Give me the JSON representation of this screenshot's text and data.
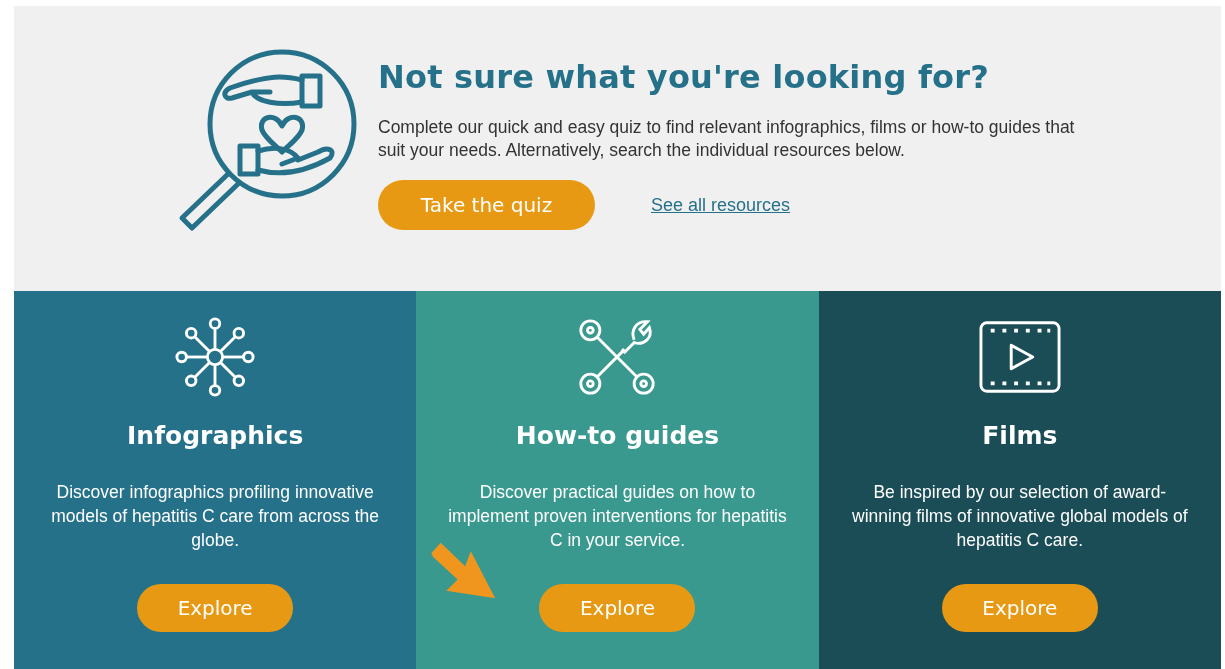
{
  "hero": {
    "title": "Not sure what you're looking for?",
    "text": "Complete our quick and easy quiz to find relevant infographics, films or how-to guides that suit your needs. Alternatively, search the individual resources below.",
    "button": "Take the quiz",
    "link": "See all resources"
  },
  "cards": [
    {
      "kind": "infographics",
      "color": "#26718a",
      "title": "Infographics",
      "text": "Discover infographics profiling innovative models of hepatitis C care from across the globe.",
      "button": "Explore",
      "highlighted": false
    },
    {
      "kind": "guides",
      "color": "#3a998f",
      "title": "How-to guides",
      "text": "Discover practical guides on how to implement proven interventions for hepatitis C in your service.",
      "button": "Explore",
      "highlighted": true
    },
    {
      "kind": "films",
      "color": "#1b4d57",
      "title": "Films",
      "text": "Be inspired by our selection of award-winning films of innovative global models of hepatitis C care.",
      "button": "Explore",
      "highlighted": false
    }
  ]
}
